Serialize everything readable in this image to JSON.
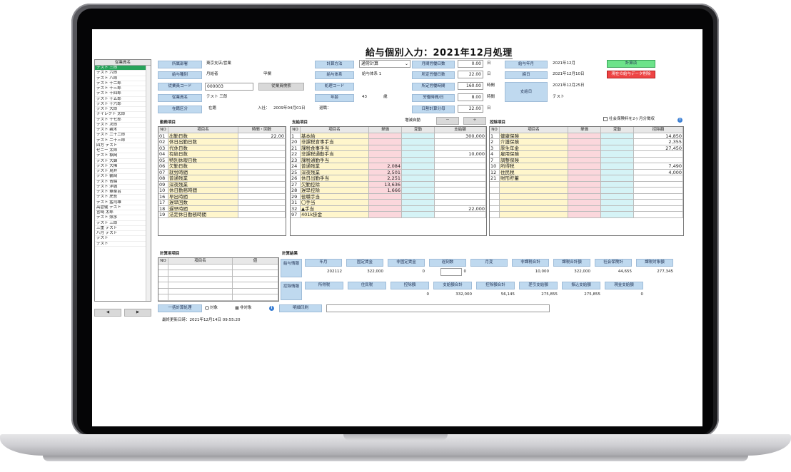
{
  "title": "給与個別入力：2021年12月処理",
  "employee_list": {
    "header": "従業員名",
    "items": [
      "テスト 三郎",
      "テスト 六郎",
      "テスト 八郎",
      "テスト 十二郎",
      "テスト 十三郎",
      "テスト 十四郎",
      "テスト 十五郎",
      "テスト 十六郎",
      "テスト 大郎",
      "ナイレクト 太郎",
      "テスト 十七郎",
      "テスト 次郎",
      "テスト 親木",
      "テスト 二十二郎",
      "テスト 二十三郎",
      "四方 テスト",
      "ゼニー 太郎",
      "テスト 稲岡",
      "テスト 大輝",
      "テスト 大稀",
      "テスト 鳥井",
      "テスト 鶴岡",
      "テスト 青綿",
      "テスト 洋城",
      "テスト 華楽呂",
      "テスト 虎吾",
      "テスト 猛司雄",
      "高倉健 テスト",
      "宮崎 太郎",
      "テスト 照水",
      "テスト 三郎",
      "三重 テスト",
      "八月 テスト",
      "テスト",
      "テスト"
    ],
    "prev": "◀",
    "next": "▶"
  },
  "header": {
    "dept_label": "所属部署",
    "dept_value": "東京支店/営業",
    "payroll_type_label": "給与種別",
    "payroll_type_value": "月給者",
    "payroll_type_sub": "甲欄",
    "code_label": "従業員コード",
    "code_value": "000003",
    "search_btn": "従業員検索",
    "name_label": "従業員名",
    "name_value": "テスト 三郎",
    "status_label": "在籍区分",
    "status_value": "在籍",
    "join_label": "入社：",
    "join_value": "2009年04月01日",
    "leave_label": "退職：",
    "calc_label": "計算方法",
    "calc_value": "通常計算",
    "system_label": "給与体系",
    "system_value": "給与体系 1",
    "proc_label": "処理コード",
    "age_label": "年齢",
    "age_value": "43",
    "age_unit": "歳",
    "m_work_days_label": "月間労働日数",
    "m_work_days_value": "0.00",
    "m_work_days_unit": "日",
    "std_days_label": "所定労働日数",
    "std_days_value": "22.00",
    "std_days_unit": "日",
    "std_hours_label": "所定労働時間",
    "std_hours_value": "160.00",
    "std_hours_unit": "時間",
    "work_hours_label": "労働時間/日",
    "work_hours_value": "8.00",
    "work_hours_unit": "時間",
    "daily_calc_label": "日割計算分母",
    "daily_calc_value": "22.00",
    "daily_calc_unit": "日",
    "pay_month_label": "給与年月",
    "pay_month_value": "2021年12月",
    "calc_date_label": "締日",
    "calc_date_value": "2021年12月10日",
    "pay_date_label": "支給日",
    "pay_date_value": "2021年12月25日",
    "memo_value": "テスト",
    "status_btn": "計算済",
    "clear_btn": "現在の給与データ削除"
  },
  "sections": {
    "attendance": "勤務項目",
    "payment": "支給項目",
    "deduction": "控除項目",
    "calc_items": "計算用項目",
    "result": "計算結果",
    "increment_label": "増減自動",
    "minus": "－",
    "plus": "＋",
    "insurance_check": "社会保険料を2ヶ月分徴収"
  },
  "attendance": {
    "cols": [
      "NO",
      "項目名",
      "時間・回数"
    ],
    "rows": [
      [
        "01",
        "出勤日数",
        "22.00"
      ],
      [
        "02",
        "休日出勤日数",
        ""
      ],
      [
        "03",
        "代休日数",
        ""
      ],
      [
        "04",
        "有給日数",
        ""
      ],
      [
        "05",
        "特別休暇日数",
        ""
      ],
      [
        "06",
        "欠勤日数",
        ""
      ],
      [
        "07",
        "就労時間",
        ""
      ],
      [
        "08",
        "普通残業",
        ""
      ],
      [
        "09",
        "深夜残業",
        ""
      ],
      [
        "10",
        "休日勤務時間",
        ""
      ],
      [
        "16",
        "早出時間",
        ""
      ],
      [
        "17",
        "遅早回数",
        ""
      ],
      [
        "18",
        "遅早時間",
        ""
      ],
      [
        "19",
        "法定休日勤務時間",
        ""
      ]
    ]
  },
  "payment": {
    "cols": [
      "NO",
      "項目名",
      "単価",
      "変動",
      "支給額"
    ],
    "rows": [
      [
        "1",
        "基本給",
        "",
        "",
        "300,000"
      ],
      [
        "20",
        "非課税食事手当",
        "",
        "",
        ""
      ],
      [
        "21",
        "課税食事手当",
        "",
        "",
        ""
      ],
      [
        "22",
        "非課税通勤手当",
        "",
        "",
        "10,000"
      ],
      [
        "23",
        "課税通勤手当",
        "",
        "",
        ""
      ],
      [
        "24",
        "普通残業",
        "2,084",
        "",
        ""
      ],
      [
        "25",
        "深夜残業",
        "2,501",
        "",
        ""
      ],
      [
        "26",
        "休日出勤手当",
        "2,251",
        "",
        ""
      ],
      [
        "27",
        "欠勤控除",
        "13,636",
        "",
        ""
      ],
      [
        "28",
        "遅早控除",
        "1,666",
        "",
        ""
      ],
      [
        "29",
        "役職手当",
        "",
        "",
        ""
      ],
      [
        "31",
        "〇手当",
        "",
        "",
        ""
      ],
      [
        "32",
        "▲手当",
        "",
        "",
        "22,000"
      ],
      [
        "97",
        "401k掛金",
        "",
        "",
        ""
      ]
    ]
  },
  "deduction": {
    "cols": [
      "NO",
      "項目名",
      "単価",
      "変動",
      "控除額"
    ],
    "rows": [
      [
        "1",
        "健康保険",
        "",
        "",
        "14,850"
      ],
      [
        "2",
        "介護保険",
        "",
        "",
        "2,355"
      ],
      [
        "3",
        "厚生年金",
        "",
        "",
        "27,450"
      ],
      [
        "4",
        "雇用保険",
        "",
        "",
        ""
      ],
      [
        "7",
        "調整保険",
        "",
        "",
        ""
      ],
      [
        "10",
        "所得税",
        "",
        "",
        "7,490"
      ],
      [
        "12",
        "住民税",
        "",
        "",
        "4,000"
      ],
      [
        "21",
        "財形貯蓄",
        "",
        "",
        ""
      ]
    ]
  },
  "calc_items": {
    "cols": [
      "NO",
      "項目名",
      "値"
    ]
  },
  "result": {
    "group1_label": "給与情報",
    "group1_heads": [
      "年月",
      "固定賃金",
      "非固定賃金",
      "遅刻数",
      "月変",
      "非課税合計",
      "課税合計額",
      "社会保険計",
      "課税対象額"
    ],
    "group1_vals": [
      "202112",
      "322,000",
      "0",
      "0",
      "",
      "10,000",
      "322,000",
      "44,655",
      "277,345"
    ],
    "group2_label": "控除情報",
    "group2_heads": [
      "所得税",
      "住民税",
      "控除額",
      "支給額合計",
      "控除額合計",
      "差引支給額",
      "振込支給額",
      "現金支給額"
    ],
    "group2_vals": [
      "",
      "",
      "0",
      "332,000",
      "56,145",
      "275,855",
      "275,855",
      "0"
    ]
  },
  "footer": {
    "bulk_btn": "一括計算処理",
    "radio_target": "対象",
    "radio_nontarget": "非対象",
    "print_btn": "明細印刷",
    "updated": "最終更新日時：2021年12月14日 09:55:20"
  },
  "colors": {
    "button_blue": "#bfd9ef",
    "selected_green": "#27a35a",
    "status_green": "#6de38a",
    "delete_red": "#ee4444",
    "cell_yellow": "#fff6cc",
    "cell_pink": "#fbd7dc",
    "cell_cyan": "#d5f3f6"
  }
}
